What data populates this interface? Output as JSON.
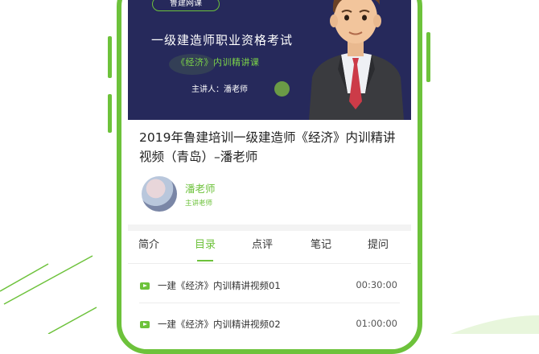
{
  "banner": {
    "pill_label": "鲁建网课",
    "title": "一级建造师职业资格考试",
    "subtitle": "《经济》内训精讲课",
    "lecturer": "主讲人：潘老师"
  },
  "course": {
    "title": "2019年鲁建培训一级建造师《经济》内训精讲视频（青岛）–潘老师"
  },
  "teacher": {
    "name": "潘老师",
    "role": "主讲老师"
  },
  "tabs": [
    {
      "label": "简介",
      "active": false
    },
    {
      "label": "目录",
      "active": true
    },
    {
      "label": "点评",
      "active": false
    },
    {
      "label": "笔记",
      "active": false
    },
    {
      "label": "提问",
      "active": false
    }
  ],
  "lessons": [
    {
      "title": "一建《经济》内训精讲视频01",
      "duration": "00:30:00"
    },
    {
      "title": "一建《经济》内训精讲视频02",
      "duration": "01:00:00"
    }
  ],
  "colors": {
    "accent": "#6dc23b",
    "banner_bg": "#26295b"
  }
}
